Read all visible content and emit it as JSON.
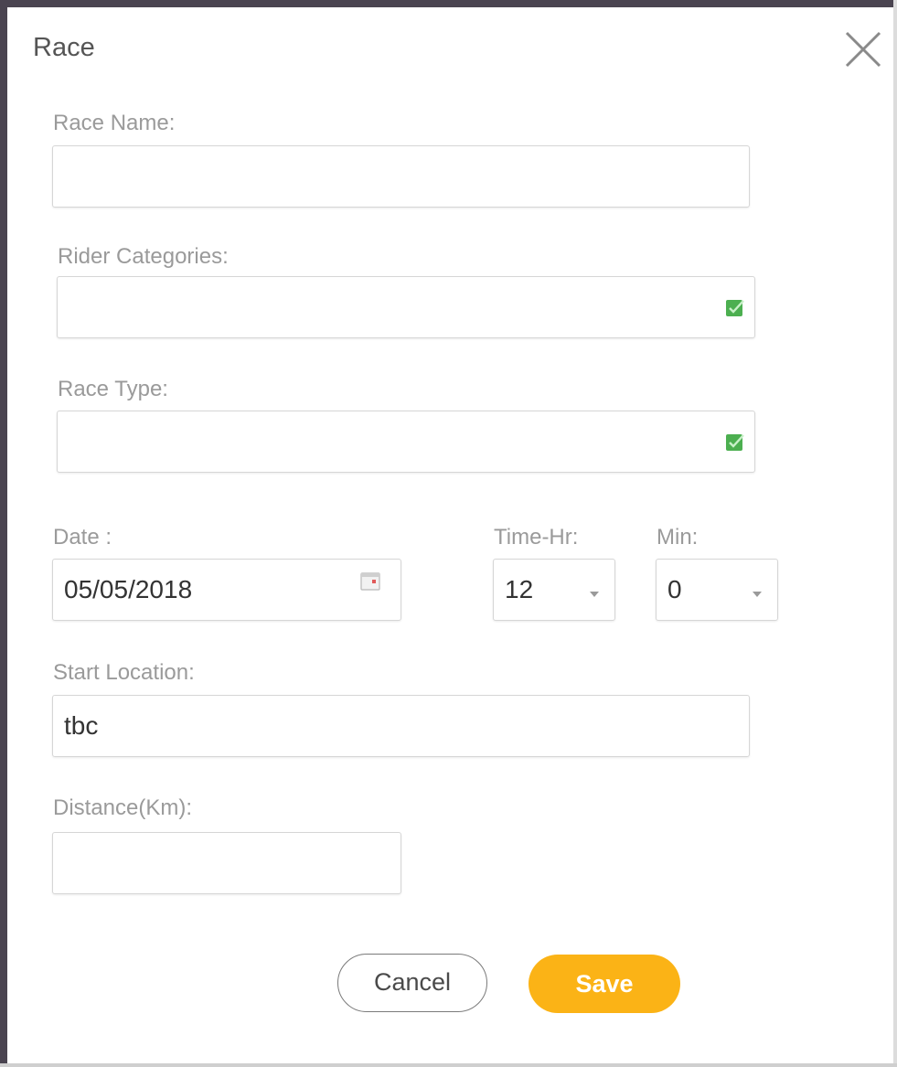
{
  "dialog": {
    "title": "Race",
    "close_icon": "close-icon"
  },
  "form": {
    "race_name": {
      "label": "Race Name:",
      "value": ""
    },
    "rider_categories": {
      "label": "Rider Categories:",
      "value": "",
      "icon": "checkbox-icon"
    },
    "race_type": {
      "label": "Race Type:",
      "value": "",
      "icon": "checkbox-icon"
    },
    "date": {
      "label": "Date :",
      "value": "05/05/2018",
      "icon": "calendar-icon"
    },
    "time_hr": {
      "label": "Time-Hr:",
      "value": "12"
    },
    "min": {
      "label": "Min:",
      "value": "0"
    },
    "start_location": {
      "label": "Start Location:",
      "value": "tbc"
    },
    "distance": {
      "label": "Distance(Km):",
      "value": ""
    }
  },
  "actions": {
    "cancel_label": "Cancel",
    "save_label": "Save"
  },
  "colors": {
    "save_button": "#fbb316",
    "check_icon": "#4caf50",
    "label_text": "#9a9a9a"
  }
}
